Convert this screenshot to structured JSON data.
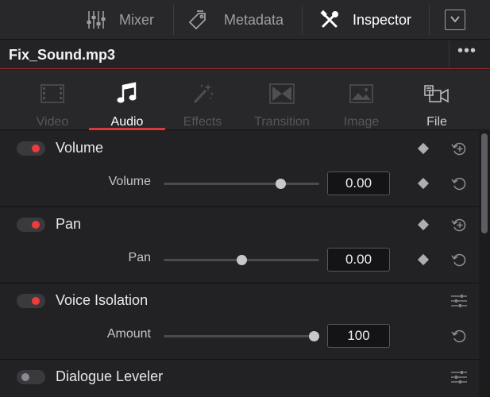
{
  "toolbar": {
    "mixer_label": "Mixer",
    "metadata_label": "Metadata",
    "inspector_label": "Inspector"
  },
  "title": {
    "filename": "Fix_Sound.mp3",
    "more": "•••"
  },
  "tabs": [
    {
      "label": "Video",
      "icon": "film-icon",
      "state": "disabled"
    },
    {
      "label": "Audio",
      "icon": "music-note-icon",
      "state": "active"
    },
    {
      "label": "Effects",
      "icon": "magic-wand-icon",
      "state": "disabled"
    },
    {
      "label": "Transition",
      "icon": "transition-icon",
      "state": "disabled"
    },
    {
      "label": "Image",
      "icon": "image-icon",
      "state": "disabled"
    },
    {
      "label": "File",
      "icon": "file-icon",
      "state": "enabled"
    }
  ],
  "sections": {
    "volume": {
      "title": "Volume",
      "enabled": true,
      "param_label": "Volume",
      "value": "0.00",
      "slider_fraction": 0.77
    },
    "pan": {
      "title": "Pan",
      "enabled": true,
      "param_label": "Pan",
      "value": "0.00",
      "slider_fraction": 0.5
    },
    "voice_isolation": {
      "title": "Voice Isolation",
      "enabled": true,
      "param_label": "Amount",
      "value": "100",
      "slider_fraction": 1.0
    },
    "dialogue_leveler": {
      "title": "Dialogue Leveler",
      "enabled": false
    }
  },
  "colors": {
    "accent_red": "#d83a3a",
    "toggle_on": "#ee3b3b",
    "background": "#1e1e21"
  }
}
